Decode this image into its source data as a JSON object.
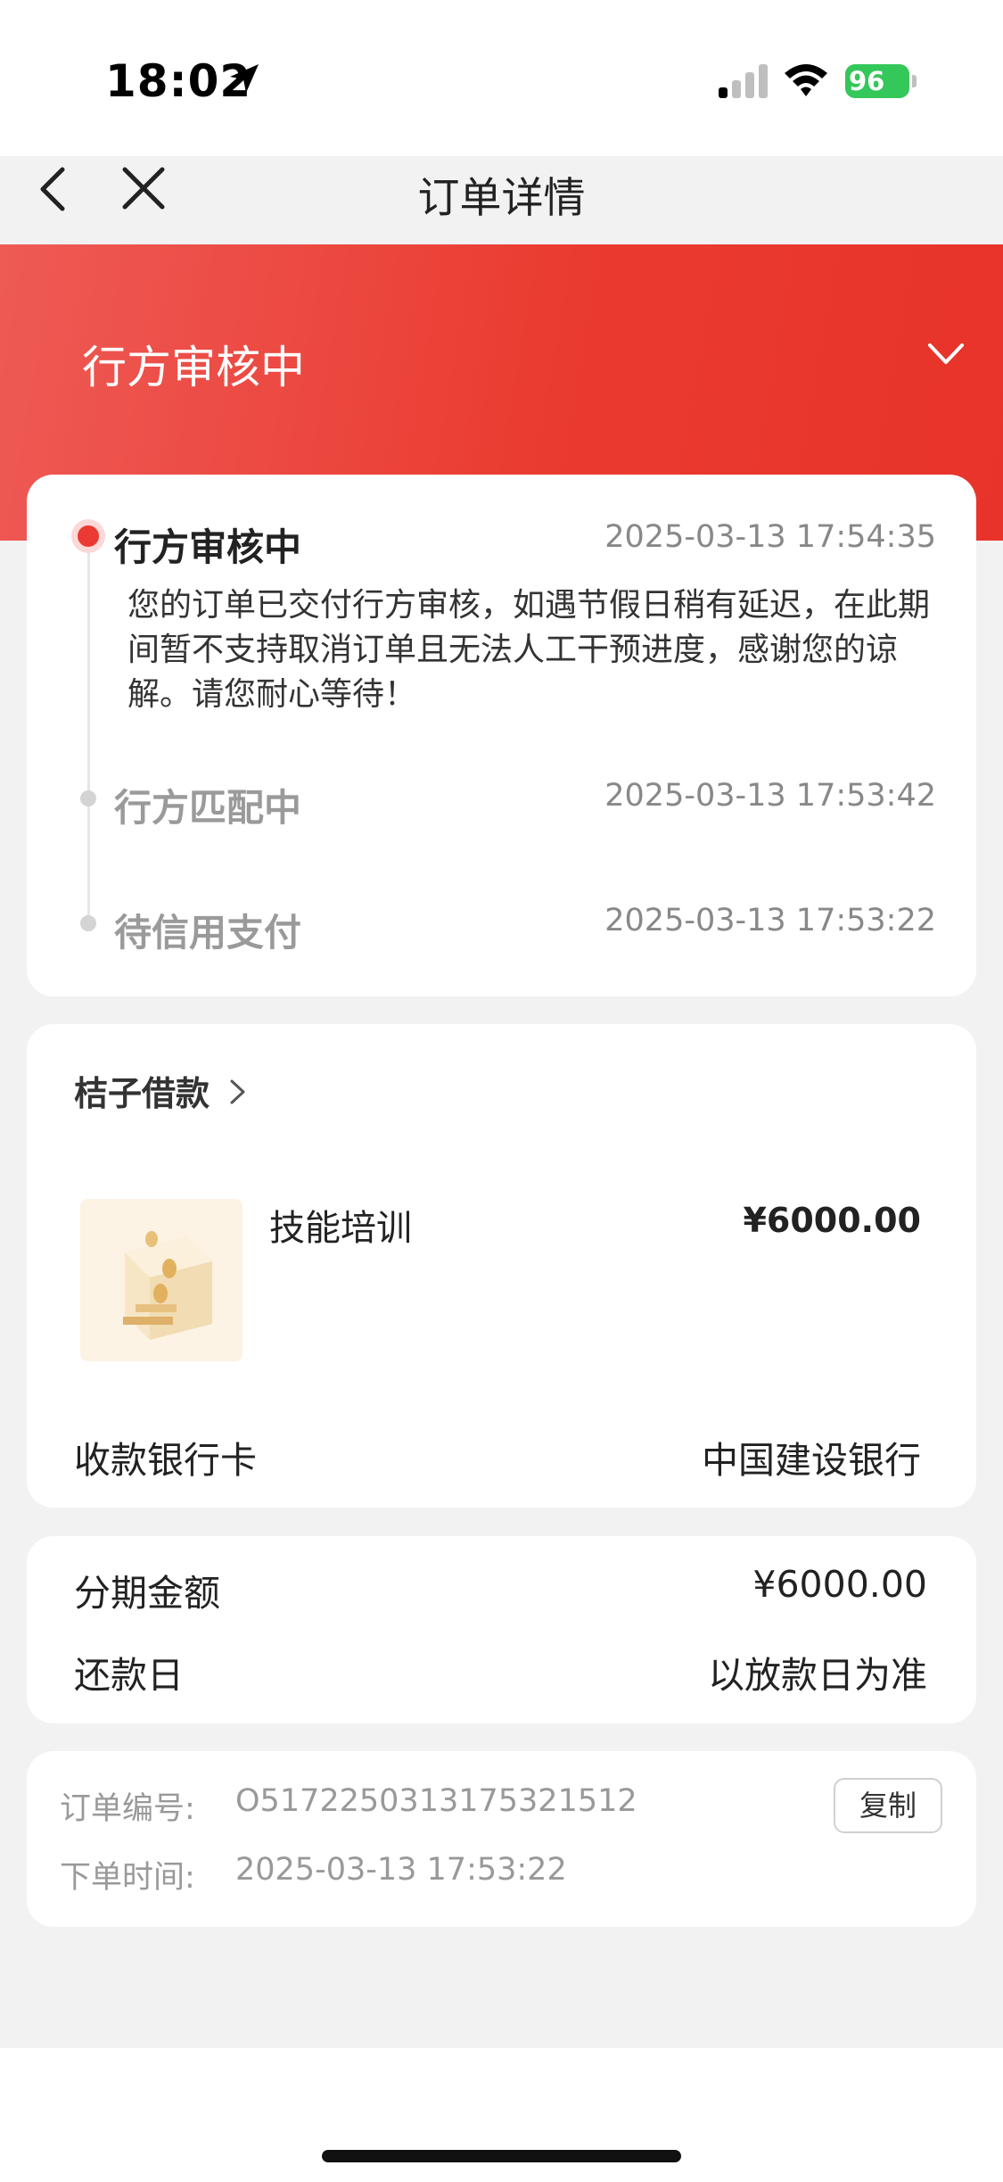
{
  "status_bar": {
    "time": "18:02",
    "battery": "96",
    "icons": [
      "location-arrow-icon",
      "signal-icon",
      "wifi-icon",
      "battery-icon"
    ]
  },
  "nav": {
    "title": "订单详情",
    "back_icon": "chevron-left-icon",
    "close_icon": "close-icon"
  },
  "hero": {
    "status": "行方审核中",
    "toggle_icon": "chevron-down-icon"
  },
  "timeline": [
    {
      "title": "行方审核中",
      "time": "2025-03-13 17:54:35",
      "desc": "您的订单已交付行方审核，如遇节假日稍有延迟，在此期间暂不支持取消订单且无法人工干预进度，感谢您的谅解。请您耐心等待！"
    },
    {
      "title": "行方匹配中",
      "time": "2025-03-13 17:53:42"
    },
    {
      "title": "待信用支付",
      "time": "2025-03-13 17:53:22"
    }
  ],
  "product": {
    "merchant": "桔子借款",
    "name": "技能培训",
    "price": "¥6000.00",
    "bank_label": "收款银行卡",
    "bank_value": "中国建设银行"
  },
  "installment": {
    "amount_label": "分期金额",
    "amount_value": "¥6000.00",
    "repay_label": "还款日",
    "repay_value": "以放款日为准"
  },
  "order": {
    "number_label": "订单编号:",
    "number_value": "O5172250313175321512",
    "copy_label": "复制",
    "time_label": "下单时间:",
    "time_value": "2025-03-13 17:53:22"
  },
  "colors": {
    "accent": "#eb3a33",
    "background": "#f2f2f2",
    "muted": "#999999"
  }
}
